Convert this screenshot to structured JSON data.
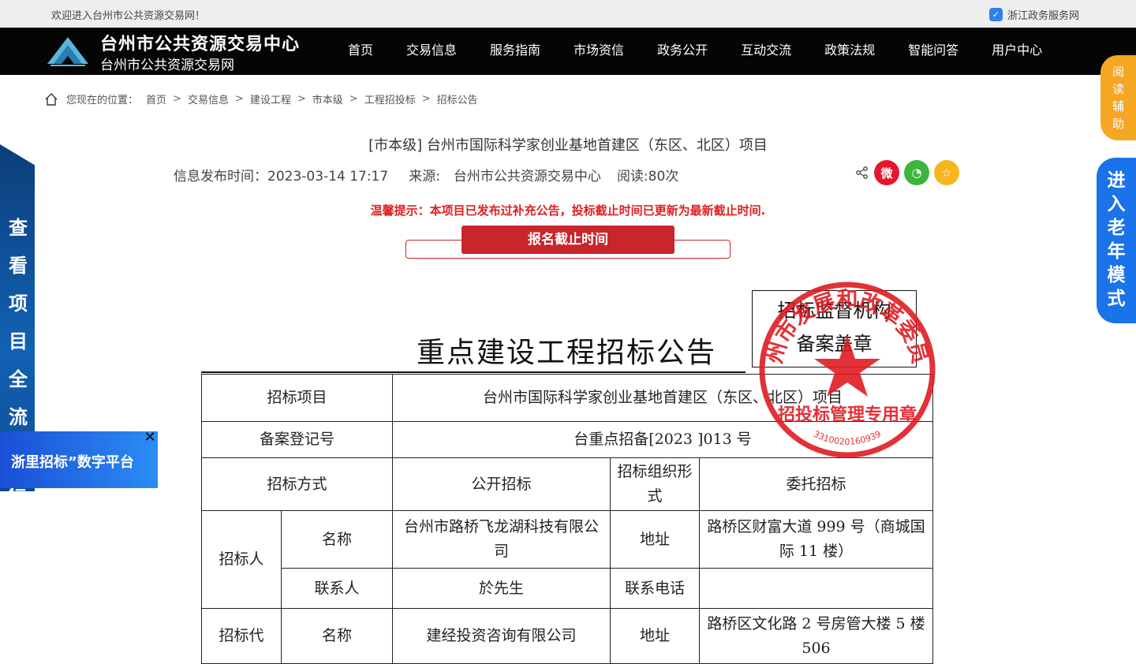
{
  "topbar": {
    "welcome": "欢迎进入台州市公共资源交易网！",
    "gov_link": "浙江政务服务网"
  },
  "header": {
    "title": "台州市公共资源交易中心",
    "subtitle": "台州市公共资源交易网",
    "nav": [
      "首页",
      "交易信息",
      "服务指南",
      "市场资信",
      "政务公开",
      "互动交流",
      "政策法规",
      "智能问答",
      "用户中心"
    ]
  },
  "breadcrumb": {
    "label": "您现在的位置：",
    "items": [
      "首页",
      "交易信息",
      "建设工程",
      "市本级",
      "工程招投标",
      "招标公告"
    ]
  },
  "article": {
    "title": "[市本级] 台州市国际科学家创业基地首建区（东区、北区）项目",
    "publish_time": "信息发布时间：2023-03-14 17:17",
    "source": "来源:　台州市公共资源交易中心",
    "reads": "阅读:80次",
    "tip": "温馨提示：本项目已发布过补充公告，投标截止时间已更新为最新截止时间.",
    "deadline_button": "报名截止时间"
  },
  "share_icons": [
    "share-icon",
    "weibo-icon",
    "wechat-icon",
    "favorite-icon"
  ],
  "colors": {
    "brand_red": "#c8262c",
    "header_bg": "#050505",
    "accent_blue": "#1a73e8",
    "assist_orange": "#f5a623"
  },
  "side": {
    "left_banner": "查看项目全流程信",
    "ad_text": "浙里招标”数字平台",
    "read_assist": "阅读辅助",
    "elder_mode": "进入老年模式"
  },
  "document": {
    "heading": "重点建设工程招标公告",
    "stamp_box_line1": "招标监督机构",
    "stamp_box_line2": "备案盖章",
    "seal_text": "台州市发展和改革委员会",
    "seal_bottom": "招投标管理专用章",
    "seal_number": "3310020160939",
    "table": {
      "project_label": "招标项目",
      "project_value": "台州市国际科学家创业基地首建区（东区、北区）项目",
      "record_label": "备案登记号",
      "record_value": "台重点招备[2023 ]013 号",
      "method_label": "招标方式",
      "method_value": "公开招标",
      "org_form_label": "招标组织形式",
      "org_form_value": "委托招标",
      "tenderer_label": "招标人",
      "name_label": "名称",
      "tenderer_name": "台州市路桥飞龙湖科技有限公司",
      "address_label": "地址",
      "tenderer_address": "路桥区财富大道 999 号（商城国际 11 楼）",
      "contact_label": "联系人",
      "contact_value": "於先生",
      "phone_label": "联系电话",
      "agent_label": "招标代",
      "agent_name": "建经投资咨询有限公司",
      "agent_address": "路桥区文化路 2 号房管大楼 5 楼 506"
    }
  }
}
